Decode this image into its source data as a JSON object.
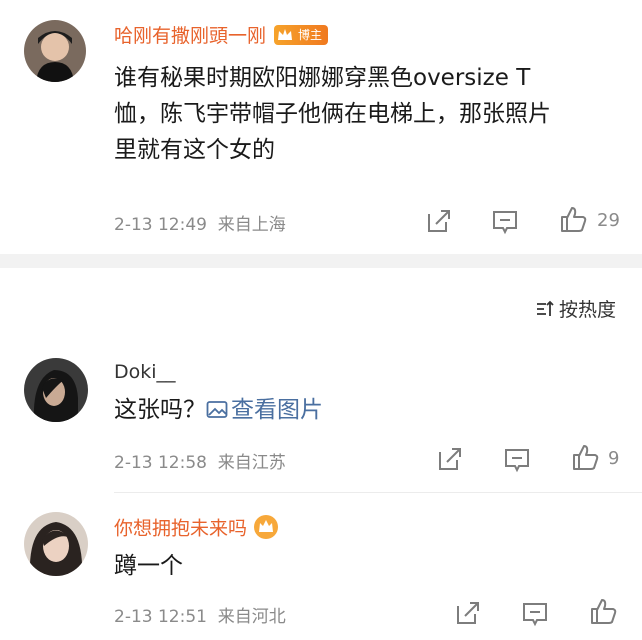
{
  "comments": [
    {
      "username": "哈刚有撒刚頭一刚",
      "badge": "博主",
      "text_lines": [
        "谁有秘果时期欧阳娜娜穿黑色oversize  T",
        "恤，陈飞宇带帽子他俩在电梯上，那张照片",
        "里就有这个女的"
      ],
      "time": "2-13 12:49",
      "source": "来自上海",
      "likes": "29"
    },
    {
      "username": "Doki__",
      "text": "这张吗？",
      "link_text": "查看图片",
      "time": "2-13 12:58",
      "source": "来自江苏",
      "likes": "9"
    },
    {
      "username": "你想拥抱未来吗",
      "text": "蹲一个",
      "time": "2-13 12:51",
      "source": "来自河北",
      "likes": ""
    }
  ],
  "sort_label": "按热度",
  "icons": [
    "share-icon",
    "comment-icon",
    "like-icon",
    "image-icon",
    "sort-icon",
    "crown-icon"
  ],
  "colors": {
    "username_vip": "#e8632c",
    "link": "#4a6fa0",
    "meta": "#8a8a8a",
    "badge": "#f0791f"
  }
}
